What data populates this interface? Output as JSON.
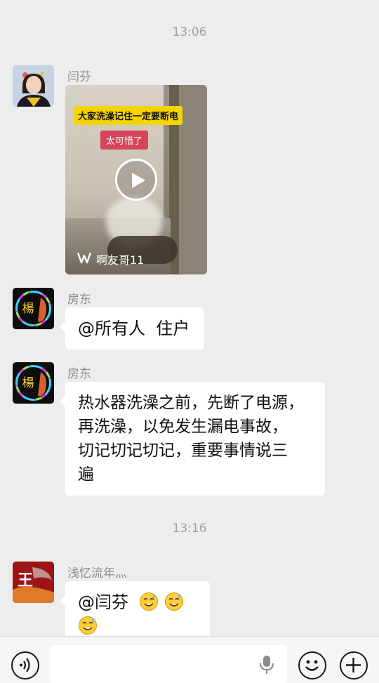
{
  "timestamps": [
    "13:06",
    "13:16"
  ],
  "messages": [
    {
      "sender": "闫芬",
      "avatar": "woman-portrait-avatar",
      "type": "video",
      "video": {
        "caption_top": "大家洗澡记住一定要断电",
        "caption_sub": "太可惜了",
        "brand": "啊友哥11",
        "brand_icon": "kuaishou-logo-icon"
      }
    },
    {
      "sender": "房东",
      "avatar": "yang-neon-avatar",
      "type": "text",
      "text": "@所有人  住户"
    },
    {
      "sender": "房东",
      "avatar": "yang-neon-avatar",
      "type": "text",
      "lines": [
        "热水器洗澡之前，先断了电源，",
        "再洗澡，以免发生漏电事故，",
        "切记切记切记，重要事情说三",
        "遍"
      ]
    },
    {
      "sender": "浅忆流年灬",
      "avatar": "wang-red-avatar",
      "type": "text",
      "text": "@闫芬 ",
      "emoji": [
        "sweat-smile-emoji",
        "sweat-smile-emoji",
        "sweat-smile-emoji"
      ]
    }
  ],
  "avatar_text": {
    "yang": "楊",
    "wang": "王"
  },
  "input_bar": {
    "voice_icon": "voice-icon",
    "mic_icon": "microphone-icon",
    "emoji_icon": "emoji-icon",
    "plus_icon": "plus-icon"
  },
  "colors": {
    "background": "#ededed",
    "bubble": "#ffffff",
    "timestamp": "#a0a0a0",
    "sender": "#8c8c8c"
  }
}
